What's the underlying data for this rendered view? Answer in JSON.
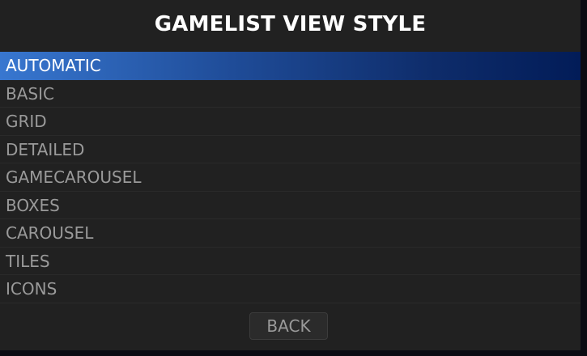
{
  "title": "GAMELIST VIEW STYLE",
  "items": [
    {
      "label": "AUTOMATIC",
      "selected": true
    },
    {
      "label": "BASIC"
    },
    {
      "label": "GRID"
    },
    {
      "label": "DETAILED"
    },
    {
      "label": "GAMECAROUSEL"
    },
    {
      "label": "BOXES"
    },
    {
      "label": "CAROUSEL"
    },
    {
      "label": "TILES"
    },
    {
      "label": "ICONS"
    }
  ],
  "back_label": "BACK",
  "colors": {
    "panel": "#212121",
    "selection_start": "#3877d0",
    "selection_end": "#021c58",
    "text": "#9a9a9a",
    "selected_text": "#ffffff"
  }
}
